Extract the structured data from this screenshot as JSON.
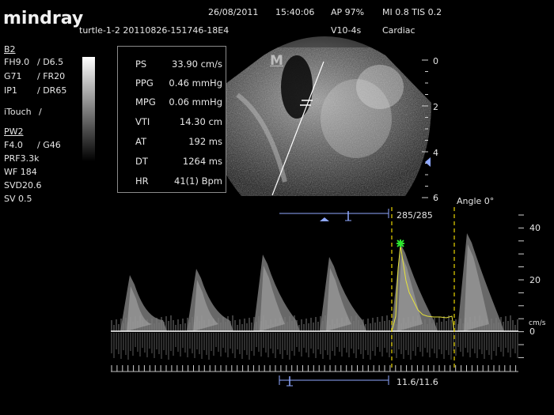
{
  "brand": "mindray",
  "header": {
    "study_id": "turtle-1-2 20110826-151746-18E4",
    "date": "26/08/2011",
    "time": "15:40:06",
    "ap": "AP  97%",
    "mi_tis": "MI 0.8 TIS 0.2",
    "probe": "V10-4s",
    "exam": "Cardiac"
  },
  "b2_params": {
    "title": "B2",
    "fh": "FH9.0",
    "d": "/ D6.5",
    "g": "G71",
    "fr": "/ FR20",
    "ip": "IP1",
    "dr": "/ DR65",
    "itouch": "iTouch",
    "itouch_val": "/"
  },
  "pw2_params": {
    "title": "PW2",
    "f": "F4.0",
    "g": "/ G46",
    "prf": "PRF3.3k",
    "wf": "WF 184",
    "svd": "SVD20.6",
    "sv": "SV 0.5"
  },
  "measurements": [
    {
      "label": "PS",
      "value": "33.90 cm/s"
    },
    {
      "label": "PPG",
      "value": "0.46 mmHg"
    },
    {
      "label": "MPG",
      "value": "0.06 mmHg"
    },
    {
      "label": "VTI",
      "value": "14.30 cm"
    },
    {
      "label": "AT",
      "value": "192 ms"
    },
    {
      "label": "DT",
      "value": "1264 ms"
    },
    {
      "label": "HR",
      "value": "41(1) Bpm"
    }
  ],
  "image_marker": "M",
  "depth_scale": [
    "0",
    "2",
    "4",
    "6"
  ],
  "cine_frame": "285/285",
  "angle": "Angle 0°",
  "velocity_scale": [
    "40",
    "20",
    "0"
  ],
  "velocity_unit": "cm/s",
  "cine_time": "11.6/11.6",
  "colors": {
    "trace": "#e8e43a",
    "caliper": "#e8d400",
    "peak_marker": "#2ee82e",
    "bar": "#8fa8ff"
  }
}
